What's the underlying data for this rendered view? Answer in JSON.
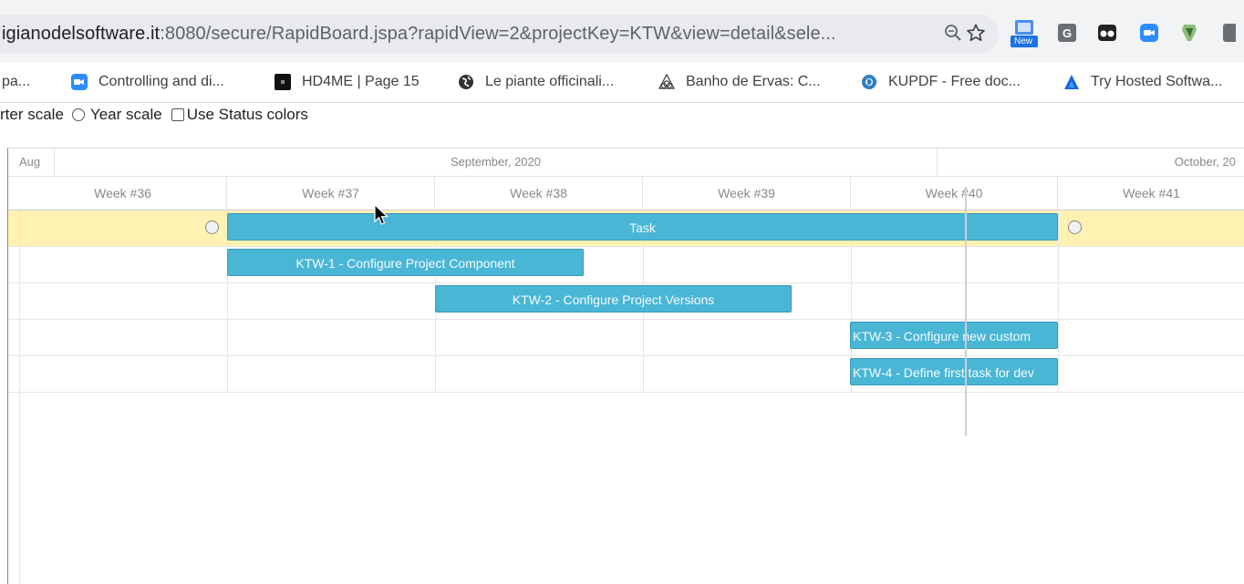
{
  "browser": {
    "url_domain": "igianodelsoftware.it",
    "url_rest": ":8080/secure/RapidBoard.jspa?rapidView=2&projectKey=KTW&view=detail&sele...",
    "extensions": {
      "new_badge": "New",
      "g_label": "G"
    }
  },
  "bookmarks": [
    {
      "label": "pa...",
      "icon": "none"
    },
    {
      "label": "Controlling and di...",
      "icon": "zoom-video-icon"
    },
    {
      "label": "HD4ME | Page 15",
      "icon": "black-square-icon"
    },
    {
      "label": "Le piante officinali...",
      "icon": "globe-icon"
    },
    {
      "label": "Banho de Ervas: C...",
      "icon": "sacred-geometry-icon"
    },
    {
      "label": "KUPDF - Free doc...",
      "icon": "kupdf-icon"
    },
    {
      "label": "Try Hosted Softwa...",
      "icon": "atlassian-icon"
    }
  ],
  "scale_options": {
    "quarter_scale": "rter scale",
    "year_scale": "Year scale",
    "use_status_colors": "Use Status colors"
  },
  "gantt": {
    "months": [
      "Aug",
      "September, 2020",
      "October, 20"
    ],
    "weeks": [
      "Week #36",
      "Week #37",
      "Week #38",
      "Week #39",
      "Week #40",
      "Week #41"
    ],
    "tasks": [
      {
        "label": "Task"
      },
      {
        "label": "KTW-1 - Configure Project Component"
      },
      {
        "label": "KTW-2 - Configure Project Versions"
      },
      {
        "label": "KTW-3 - Configure new custom"
      },
      {
        "label": "KTW-4 - Define first task for dev"
      }
    ]
  },
  "colors": {
    "bar": "#4ab6d6",
    "summary_row": "#fff2b3",
    "accent": "#1a73e8"
  }
}
